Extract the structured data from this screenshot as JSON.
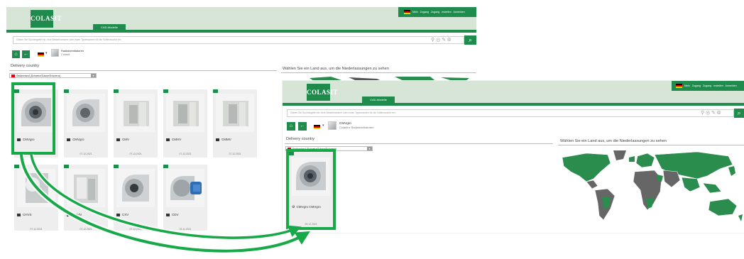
{
  "colors": {
    "brand_green": "#1f8b4c",
    "highlight_green": "#17a847",
    "header_bg": "#d7e5d6",
    "card_bg": "#eeeeee"
  },
  "logo": {
    "text": "COLASIT"
  },
  "topbar": {
    "links": "Mein Zugang   Zugang erstellen   Anmelden"
  },
  "search": {
    "placeholder": "Geben Sie Suchbegriffe ein, eine Bestellnummer oder einen Typennamen für die Volltextsuche ein"
  },
  "window1": {
    "tab_label": "CAD-Modelle",
    "breadcrumb": {
      "title": "Radialventilatoren",
      "sub": "Colasit"
    },
    "delivery_title": "Delivery country",
    "country_select": "Switzerland (Schweiz/Suisse/Svizzera)",
    "map_title": "Wählen Sie ein Land aus, um die Niederlassungen zu sehen",
    "products": [
      {
        "name": "CMVgro",
        "date": "07.12.2021"
      },
      {
        "name": "CMVgro",
        "date": "07.12.2021"
      },
      {
        "name": "CMV",
        "date": "07.12.2021"
      },
      {
        "name": "CMHV",
        "date": "07.12.2021"
      },
      {
        "name": "CMMV",
        "date": "07.12.2021"
      },
      {
        "name": "CHVS",
        "date": "07.12.2021"
      },
      {
        "name": "CHVN",
        "date": "07.12.2021"
      },
      {
        "name": "CXV",
        "date": "07.12.2021"
      },
      {
        "name": "CDV",
        "date": "23.11.2021"
      }
    ]
  },
  "window2": {
    "tab_label": "CAD-Modelle",
    "breadcrumb": {
      "title": "CMVgro",
      "sub": "Colasit ▸ Radialventilatoren"
    },
    "delivery_title": "Delivery country",
    "country_select": "Switzerland (Schweiz/Suisse/Svizzera)",
    "map_title": "Wählen Sie ein Land aus, um die Niederlassungen zu sehen",
    "product": {
      "name": "CMVgro   CMVgro",
      "date": "03.12.2021"
    }
  }
}
